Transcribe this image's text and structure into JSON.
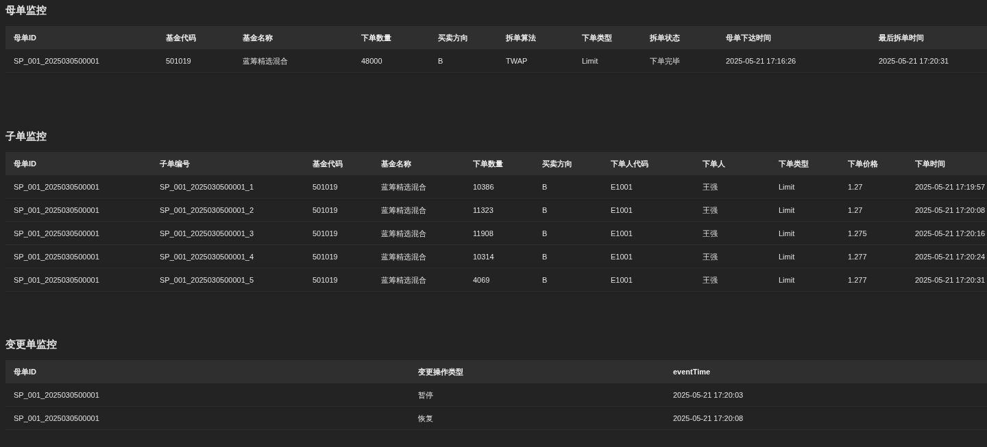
{
  "sections": [
    {
      "title": "母单监控",
      "columns": [
        "母单ID",
        "基金代码",
        "基金名称",
        "下单数量",
        "买卖方向",
        "拆单算法",
        "下单类型",
        "拆单状态",
        "母单下达时间",
        "最后拆单时间"
      ],
      "rows": [
        [
          "SP_001_2025030500001",
          "501019",
          "蓝筹精选混合",
          "48000",
          "B",
          "TWAP",
          "Limit",
          "下单完毕",
          "2025-05-21 17:16:26",
          "2025-05-21 17:20:31"
        ]
      ]
    },
    {
      "title": "子单监控",
      "columns": [
        "母单ID",
        "子单编号",
        "基金代码",
        "基金名称",
        "下单数量",
        "买卖方向",
        "下单人代码",
        "下单人",
        "下单类型",
        "下单价格",
        "下单时间"
      ],
      "rows": [
        [
          "SP_001_2025030500001",
          "SP_001_2025030500001_1",
          "501019",
          "蓝筹精选混合",
          "10386",
          "B",
          "E1001",
          "王强",
          "Limit",
          "1.27",
          "2025-05-21 17:19:57"
        ],
        [
          "SP_001_2025030500001",
          "SP_001_2025030500001_2",
          "501019",
          "蓝筹精选混合",
          "11323",
          "B",
          "E1001",
          "王强",
          "Limit",
          "1.27",
          "2025-05-21 17:20:08"
        ],
        [
          "SP_001_2025030500001",
          "SP_001_2025030500001_3",
          "501019",
          "蓝筹精选混合",
          "11908",
          "B",
          "E1001",
          "王强",
          "Limit",
          "1.275",
          "2025-05-21 17:20:16"
        ],
        [
          "SP_001_2025030500001",
          "SP_001_2025030500001_4",
          "501019",
          "蓝筹精选混合",
          "10314",
          "B",
          "E1001",
          "王强",
          "Limit",
          "1.277",
          "2025-05-21 17:20:24"
        ],
        [
          "SP_001_2025030500001",
          "SP_001_2025030500001_5",
          "501019",
          "蓝筹精选混合",
          "4069",
          "B",
          "E1001",
          "王强",
          "Limit",
          "1.277",
          "2025-05-21 17:20:31"
        ]
      ]
    },
    {
      "title": "变更单监控",
      "columns": [
        "母单ID",
        "变更操作类型",
        "eventTime"
      ],
      "rows": [
        [
          "SP_001_2025030500001",
          "暂停",
          "2025-05-21 17:20:03"
        ],
        [
          "SP_001_2025030500001",
          "恢复",
          "2025-05-21 17:20:08"
        ]
      ]
    }
  ]
}
